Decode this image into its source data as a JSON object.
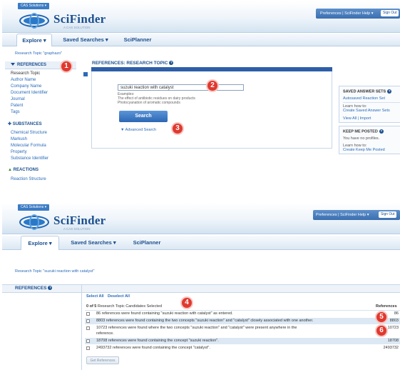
{
  "screen1": {
    "cas_tab": "CAS Solutions ▾",
    "logo": {
      "name": "SciFinder",
      "sub": "A CAS SOLUTION"
    },
    "top_links": "Preferences  |  SciFinder Help ▾",
    "sign_in": "Sign Out",
    "nav": {
      "explore": "Explore ▾",
      "saved": "Saved Searches ▾",
      "planner": "SciPlanner"
    },
    "research_topic_label": "Research Topic \"graphazo\"",
    "sidebar": {
      "references_header": "REFERENCES",
      "references_items": [
        "Research Topic",
        "Author Name",
        "Company Name",
        "Document Identifier",
        "Journal",
        "Patent",
        "Tags"
      ],
      "substances_header": "SUBSTANCES",
      "substances_items": [
        "Chemical Structure",
        "Markush",
        "Molecular Formula",
        "Property",
        "Substance Identifier"
      ],
      "reactions_header": "REACTIONS",
      "reactions_items": [
        "Reaction Structure"
      ]
    },
    "panel_title": "REFERENCES: RESEARCH TOPIC",
    "search_value": "suzuki reaction with catalyst",
    "examples_label": "Examples:",
    "example1": "The effect of antibiotic residues on dairy products",
    "example2": "Photocyanation of aromatic compounds",
    "search_button": "Search",
    "advanced_search": "Advanced Search",
    "right": {
      "saved_title": "SAVED ANSWER SETS",
      "saved_link": "Autosaved Reaction Set",
      "learn1": "Learn how to:",
      "learn1_link": "Create Saved Answer Sets",
      "view_import": "View All  |  Import",
      "keep_title": "KEEP ME POSTED",
      "no_profiles": "You have no profiles.",
      "learn2": "Learn how to:",
      "learn2_link": "Create Keep Me Posted"
    },
    "badges": [
      "1",
      "2",
      "3"
    ]
  },
  "screen2": {
    "cas_tab": "CAS Solutions ▾",
    "logo": {
      "name": "SciFinder",
      "sub": "A CAS SOLUTION"
    },
    "top_links": "Preferences  |  SciFinder Help ▾",
    "sign_in": "Sign Out",
    "nav": {
      "explore": "Explore ▾",
      "saved": "Saved Searches ▾",
      "planner": "SciPlanner"
    },
    "research_topic_label": "Research Topic \"suzuki reaction with catalyst\"",
    "references_label": "REFERENCES",
    "select_all": "Select All",
    "deselect_all": "Deselect All",
    "candidates_count": "0 of 5",
    "candidates_label": "Research Topic Candidates Selected",
    "references_col": "References",
    "rows": [
      {
        "text": "86 references were found containing \"suzuki reaction with catalyst\" as entered.",
        "count": "86"
      },
      {
        "text": "8803 references were found containing the two concepts \"suzuki reaction\" and \"catalyst\" closely associated with one another.",
        "count": "8803"
      },
      {
        "text": "10723 references were found where the two concepts \"suzuki reaction\" and \"catalyst\" were present anywhere in the",
        "text2": "reference.",
        "count": "10723"
      },
      {
        "text": "18708 references were found containing the concept \"suzuki reaction\".",
        "count": "18708"
      },
      {
        "text": "2493732 references were found containing the concept \"catalyst\".",
        "count": "2493732"
      }
    ],
    "get_button": "Get References",
    "badges": [
      "4",
      "5",
      "6"
    ]
  }
}
